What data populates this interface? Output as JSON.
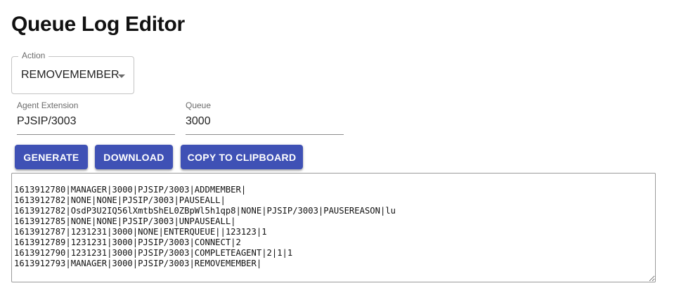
{
  "page": {
    "title": "Queue Log Editor"
  },
  "action_select": {
    "label": "Action",
    "value": "REMOVEMEMBER"
  },
  "agent_extension": {
    "label": "Agent Extension",
    "value": "PJSIP/3003"
  },
  "queue": {
    "label": "Queue",
    "value": "3000"
  },
  "buttons": {
    "generate": "GENERATE",
    "download": "DOWNLOAD",
    "copy": "COPY TO CLIPBOARD"
  },
  "output": {
    "text": "1613912780|MANAGER|3000|PJSIP/3003|ADDMEMBER|\n1613912782|NONE|NONE|PJSIP/3003|PAUSEALL|\n1613912782|OsdP3U2IQ56lXmtbShEL0ZBpWl5h1qp8|NONE|PJSIP/3003|PAUSEREASON|lu\n1613912785|NONE|NONE|PJSIP/3003|UNPAUSEALL|\n1613912787|1231231|3000|NONE|ENTERQUEUE||123123|1\n1613912789|1231231|3000|PJSIP/3003|CONNECT|2\n1613912790|1231231|3000|PJSIP/3003|COMPLETEAGENT|2|1|1\n1613912793|MANAGER|3000|PJSIP/3003|REMOVEMEMBER|"
  },
  "colors": {
    "primary_button": "#3f51b5",
    "button_text": "#ffffff"
  },
  "icons": {
    "select_arrow": "dropdown-arrow-icon"
  }
}
